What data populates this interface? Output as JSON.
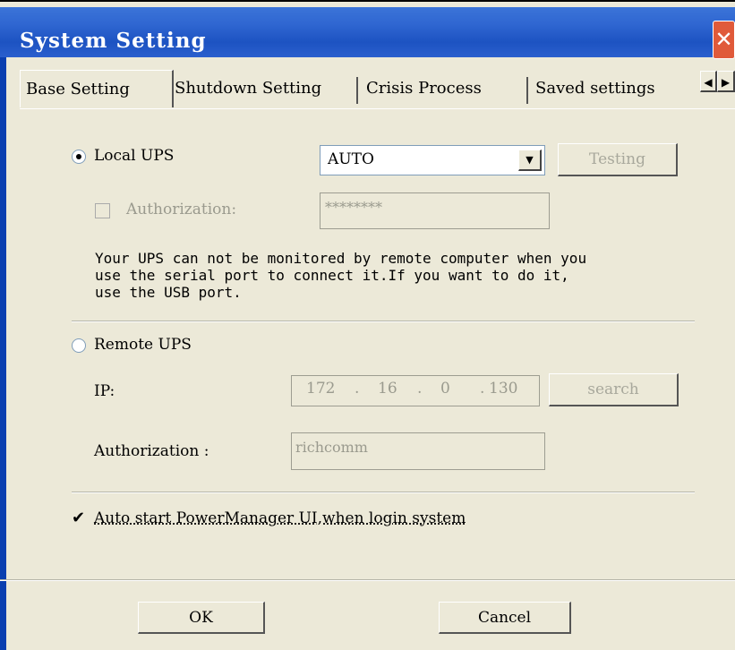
{
  "window": {
    "title": "System Setting"
  },
  "tabs": [
    {
      "label": "Base Setting"
    },
    {
      "label": "Shutdown Setting"
    },
    {
      "label": "Crisis Process"
    },
    {
      "label": "Saved settings"
    }
  ],
  "local_ups": {
    "label": "Local UPS",
    "combo_value": "AUTO",
    "testing_label": "Testing",
    "authorization_label": "Authorization:",
    "authorization_value": "********",
    "note": "Your UPS can not be monitored by remote computer when you\nuse the serial port to connect it.If you want to do it,\nuse the USB port."
  },
  "remote_ups": {
    "label": "Remote UPS",
    "ip_label": "IP:",
    "ip": [
      "172",
      "16",
      "0",
      "130"
    ],
    "search_label": "search",
    "authorization_label": "Authorization :",
    "authorization_value": "richcomm"
  },
  "autostart": {
    "label": "Auto start PowerManager UI,when login system",
    "checked": true
  },
  "buttons": {
    "ok": "OK",
    "cancel": "Cancel"
  },
  "colors": {
    "titlebar": "#2f66d1",
    "close": "#e05a3a",
    "dialog_bg": "#ece9d8"
  }
}
